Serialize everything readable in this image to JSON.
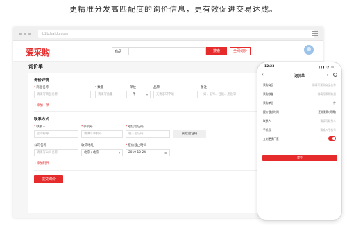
{
  "headline": "更精准分发高匹配度的询价信息，更有效促进交易达成。",
  "browser": {
    "url": "b2b.baidu.com"
  },
  "nav": {
    "logo": "爱采购",
    "search_category": "商品",
    "search_button": "搜索",
    "post_inquiry_button": "全网询价"
  },
  "page_title": "询价单",
  "inquiry_detail": {
    "title": "询价详情",
    "labels": {
      "product_name": "商品名称",
      "quantity": "数量",
      "unit": "单位",
      "brand": "品牌",
      "remark": "备注"
    },
    "placeholders": {
      "product_name": "请填写商品名称",
      "quantity": "请填写数量",
      "brand": "无要求可不填",
      "remark": "如：型号、性能、用途等"
    },
    "unit_value": "件",
    "add_link": "+添加一项"
  },
  "contact": {
    "title": "联系方式",
    "labels": {
      "contact_person": "联系人",
      "phone": "手机号",
      "sms_code": "短信验证码",
      "company": "公司名称",
      "address": "收货地址",
      "deadline": "报价截止时间"
    },
    "placeholders": {
      "contact_person": "您的称呼",
      "phone": "请填写手机号",
      "sms_code": "输入验证码",
      "company": "请填写公司名称"
    },
    "get_code_button": "获取验证码",
    "address_value": "北京 / 北京",
    "deadline_value": "2019-10-24",
    "add_attachment": "+添加附件"
  },
  "submit_button": "提交询价",
  "phone": {
    "time": "12:23",
    "status_icons": "▮▮▮ ◔ ▭",
    "title": "询价单",
    "rows": [
      {
        "key": "采购商品",
        "value": "请填写采购商品名称"
      },
      {
        "key": "采购数量",
        "value": "请填写采购数量"
      },
      {
        "key": "采购单位",
        "value": "件"
      },
      {
        "key": "报价截止时间",
        "value": "正常采购(两周)"
      },
      {
        "key": "联系人",
        "value": "请填写联系人"
      },
      {
        "key": "手机号",
        "value": "请输入手机号"
      },
      {
        "key": "立刻更多厂家",
        "value": ""
      }
    ],
    "submit": "提交"
  },
  "colors": {
    "brand": "#e52b2b"
  }
}
